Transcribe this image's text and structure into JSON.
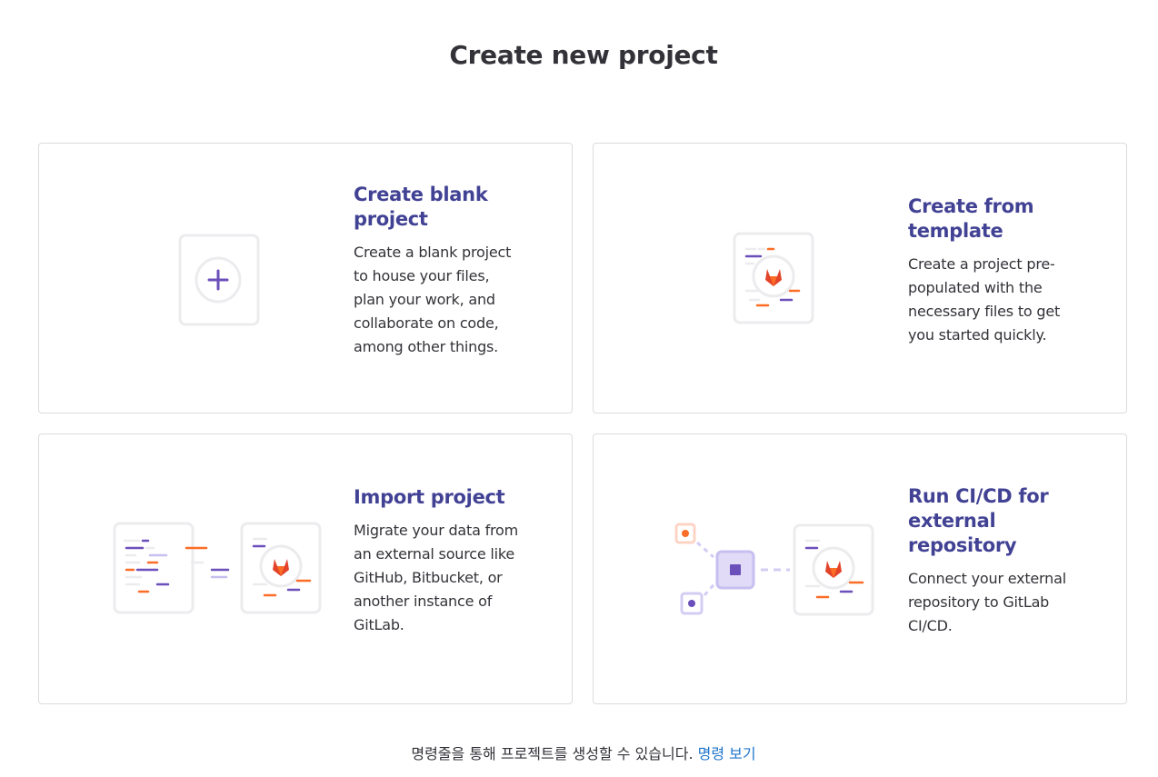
{
  "page": {
    "title": "Create new project"
  },
  "cards": [
    {
      "title": "Create blank project",
      "description": "Create a blank project to house your files, plan your work, and collaborate on code, among other things.",
      "icon": "plus-icon"
    },
    {
      "title": "Create from template",
      "description": "Create a project pre-populated with the necessary files to get you started quickly.",
      "icon": "template-icon"
    },
    {
      "title": "Import project",
      "description": "Migrate your data from an external source like GitHub, Bitbucket, or another instance of GitLab.",
      "icon": "import-icon"
    },
    {
      "title": "Run CI/CD for external repository",
      "description": "Connect your external repository to GitLab CI/CD.",
      "icon": "cicd-icon"
    }
  ],
  "footer": {
    "text": "명령줄을 통해 프로젝트를 생성할 수 있습니다.",
    "link_label": "명령 보기"
  },
  "colors": {
    "accent": "#424295",
    "link": "#1f75cb",
    "purple": "#6b4fbb",
    "orange": "#fc6d26",
    "border": "#dcdcde"
  }
}
